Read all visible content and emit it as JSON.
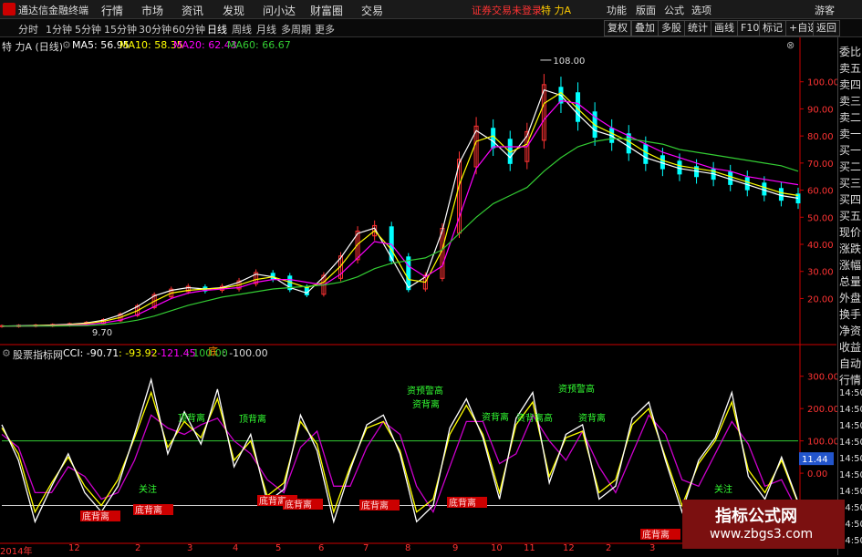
{
  "titlebar": {
    "app_name": "通达信金融终端",
    "menus": [
      "行情",
      "市场",
      "资讯",
      "发现",
      "问小达",
      "财富圈",
      "交易"
    ],
    "login_status": "证券交易未登录",
    "stock_name": "特 力A",
    "right_menus": [
      "功能",
      "版面",
      "公式",
      "选项"
    ],
    "guest": "游客"
  },
  "toolbar": {
    "periods": [
      "分时",
      "1分钟",
      "5分钟",
      "15分钟",
      "30分钟",
      "60分钟",
      "日线",
      "周线",
      "月线",
      "多周期",
      "更多"
    ],
    "active_period": "日线",
    "tools": [
      "复权",
      "叠加",
      "多股",
      "统计",
      "画线",
      "F10",
      "标记",
      "+自选",
      "返回"
    ]
  },
  "infobar": {
    "stock": "特 力A (日线)",
    "ma5": "MA5: 56.95",
    "ma10": "MA10: 58.35",
    "ma20": "MA20: 62.43",
    "ma60": "MA60: 66.67"
  },
  "indicator": {
    "name": "股票指标网",
    "cci": "CCI: -90.71",
    "v2": ": -93.92",
    "v3": ": -121.45",
    "v4": ": 100.00",
    "v5": ": -100.00"
  },
  "sidebar": [
    "委比",
    "卖五",
    "卖四",
    "卖三",
    "卖二",
    "卖一",
    "买一",
    "买二",
    "买三",
    "买四",
    "买五",
    "现价",
    "涨跌",
    "涨幅",
    "总量",
    "外盘",
    "换手",
    "净资",
    "收益",
    "自动",
    "行情",
    "14:50",
    "14:50",
    "14:50",
    "14:50",
    "14:50",
    "14:50",
    "14:50",
    "14:50",
    "14:50",
    "14:50"
  ],
  "x_axis": [
    "2014年",
    "12",
    "2",
    "3",
    "4",
    "5",
    "6",
    "7",
    "8",
    "9",
    "10",
    "11",
    "12",
    "2",
    "3"
  ],
  "annotations": {
    "high_price": "108.00",
    "low_price": "9.70",
    "ding": "底",
    "green_labels": [
      "顶背离",
      "顶背离",
      "资预警高",
      "资背离",
      "资背离",
      "资背离高",
      "资预警高",
      "资背离"
    ],
    "red_labels": [
      "底背离",
      "底背离",
      "底背离",
      "底背离",
      "底背离",
      "底背离",
      "底背离"
    ],
    "guanzhu": "关注"
  },
  "lower_value_box": "11.44",
  "watermark": {
    "line1": "指标公式网",
    "line2": "www.zbgs3.com"
  },
  "chart_data": [
    {
      "type": "candlestick",
      "title": "特 力A (日线)",
      "ylim": [
        5,
        110
      ],
      "yticks": [
        20,
        30,
        40,
        50,
        60,
        70,
        80,
        90,
        100
      ],
      "grid": false,
      "series": [
        {
          "name": "MA5",
          "color": "#ffffff",
          "values": [
            9.8,
            9.9,
            10.0,
            10.2,
            10.5,
            11,
            12,
            14,
            17,
            21,
            23,
            24,
            23.5,
            24,
            26,
            29,
            28,
            24,
            22,
            28,
            35,
            44,
            46,
            35,
            24,
            28,
            45,
            70,
            82,
            78,
            72,
            80,
            97,
            95,
            88,
            82,
            80,
            76,
            72,
            70,
            68,
            67,
            66,
            64,
            62,
            60,
            58,
            57
          ]
        },
        {
          "name": "MA10",
          "color": "#ffff00",
          "values": [
            9.8,
            9.8,
            9.9,
            10.1,
            10.3,
            10.8,
            11.6,
            13,
            15.5,
            19,
            22,
            23,
            23.5,
            23.8,
            25,
            27,
            28,
            26,
            24,
            26,
            32,
            40,
            45,
            38,
            27,
            26,
            38,
            62,
            78,
            80,
            74,
            77,
            92,
            96,
            90,
            84,
            81,
            78,
            74,
            71,
            69,
            68,
            67,
            65,
            63,
            61,
            59,
            58
          ]
        },
        {
          "name": "MA20",
          "color": "#ff00ff",
          "values": [
            9.8,
            9.8,
            9.8,
            9.9,
            10.1,
            10.4,
            11,
            12,
            14,
            17,
            20,
            22,
            23,
            23.5,
            24,
            26,
            27,
            27,
            26,
            25,
            29,
            35,
            41,
            40,
            32,
            28,
            32,
            50,
            68,
            76,
            76,
            76,
            86,
            93,
            92,
            87,
            83,
            80,
            77,
            74,
            72,
            70,
            68,
            67,
            65,
            64,
            63,
            62
          ]
        },
        {
          "name": "MA60",
          "color": "#33cc33",
          "values": [
            9.8,
            9.8,
            9.8,
            9.8,
            9.9,
            10,
            10.4,
            11,
            12,
            13.5,
            15.5,
            17.5,
            19,
            20.5,
            21.5,
            22.5,
            23.5,
            24,
            24.5,
            25,
            26,
            28,
            31,
            33,
            34,
            35,
            38,
            44,
            50,
            55,
            58,
            61,
            67,
            72,
            76,
            78,
            79,
            79,
            78,
            77,
            75,
            74,
            73,
            72,
            71,
            70,
            69,
            67
          ]
        }
      ]
    },
    {
      "type": "line",
      "title": "股票指标网",
      "ylim": [
        -200,
        350
      ],
      "yticks": [
        -100,
        0,
        100,
        200,
        300
      ],
      "hlines": [
        100,
        -100
      ],
      "series": [
        {
          "name": "CCI",
          "color": "#ffffff",
          "values": [
            150,
            40,
            -150,
            -40,
            60,
            -60,
            -120,
            -40,
            120,
            290,
            60,
            190,
            90,
            260,
            20,
            120,
            -90,
            -50,
            180,
            70,
            -150,
            10,
            150,
            180,
            60,
            -150,
            -100,
            140,
            230,
            110,
            -80,
            170,
            250,
            -30,
            120,
            150,
            -80,
            -40,
            170,
            220,
            40,
            -120,
            40,
            110,
            250,
            -10,
            -80,
            50,
            -90
          ]
        },
        {
          "name": "CCI2",
          "color": "#ffff00",
          "values": [
            140,
            60,
            -120,
            -30,
            50,
            -40,
            -100,
            -20,
            110,
            250,
            80,
            160,
            110,
            230,
            40,
            100,
            -70,
            -30,
            160,
            90,
            -120,
            20,
            140,
            160,
            70,
            -120,
            -80,
            120,
            210,
            120,
            -60,
            150,
            220,
            -10,
            110,
            130,
            -60,
            -20,
            150,
            200,
            50,
            -100,
            30,
            100,
            220,
            10,
            -60,
            40,
            -93
          ]
        },
        {
          "name": "CCI3",
          "color": "#cc00cc",
          "values": [
            120,
            80,
            -60,
            -60,
            20,
            -10,
            -80,
            -60,
            40,
            180,
            140,
            120,
            150,
            170,
            100,
            60,
            -20,
            -60,
            80,
            130,
            -40,
            -40,
            80,
            160,
            120,
            -40,
            -120,
            20,
            160,
            160,
            30,
            60,
            180,
            100,
            40,
            130,
            20,
            -60,
            60,
            180,
            120,
            -20,
            -40,
            60,
            160,
            90,
            -40,
            -20,
            -121
          ]
        }
      ]
    }
  ]
}
